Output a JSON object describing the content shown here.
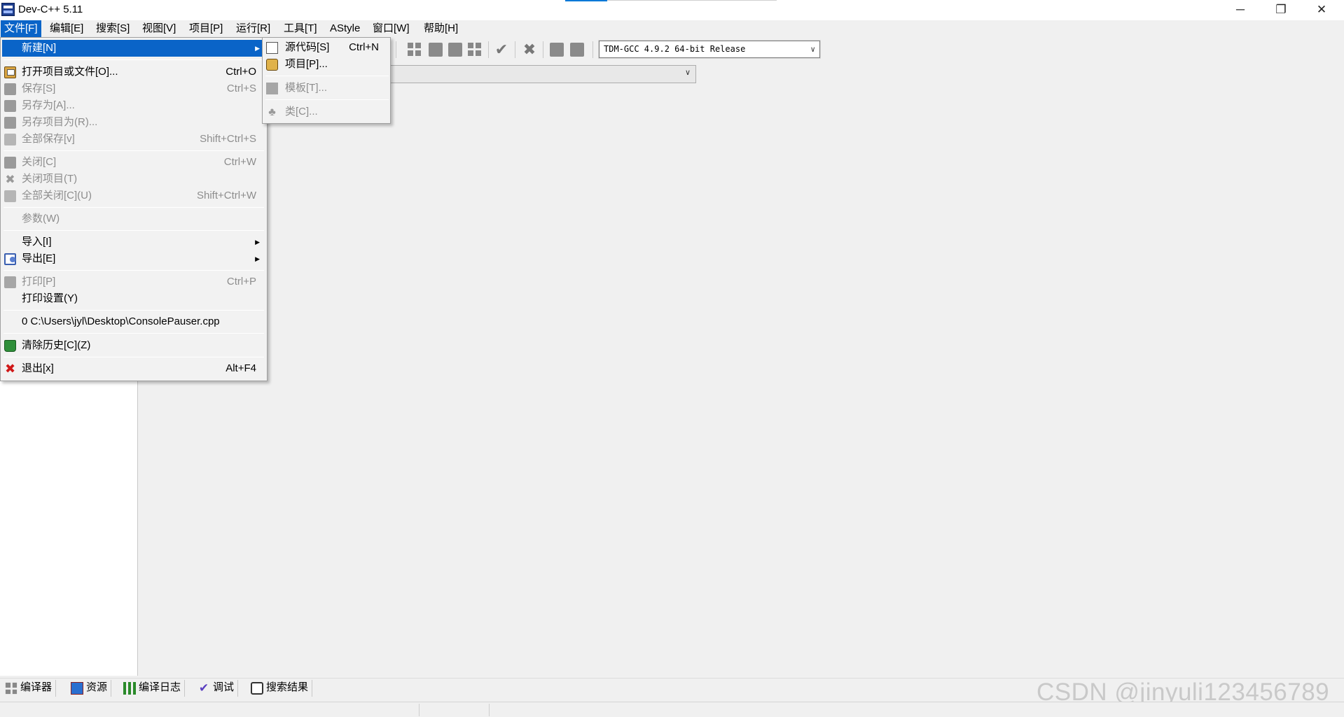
{
  "window": {
    "title": "Dev-C++ 5.11",
    "minimize_glyph": "─",
    "maximize_glyph": "❐",
    "close_glyph": "✕"
  },
  "menubar": [
    {
      "label": "文件[F]",
      "active": true
    },
    {
      "label": "编辑[E]"
    },
    {
      "label": "搜索[S]"
    },
    {
      "label": "视图[V]"
    },
    {
      "label": "项目[P]"
    },
    {
      "label": "运行[R]"
    },
    {
      "label": "工具[T]"
    },
    {
      "label": "AStyle"
    },
    {
      "label": "窗口[W]"
    },
    {
      "label": "帮助[H]"
    }
  ],
  "toolbar": {
    "compiler_select_value": "TDM-GCC 4.9.2 64-bit Release",
    "chevron": "∨"
  },
  "file_menu": {
    "items": [
      {
        "label": "新建[N]",
        "arrow": "▶",
        "highlighted": true
      },
      {
        "label": "打开项目或文件[O]...",
        "shortcut": "Ctrl+O",
        "icon": "open-icon"
      },
      {
        "label": "保存[S]",
        "shortcut": "Ctrl+S",
        "disabled": true,
        "icon": "save-icon"
      },
      {
        "label": "另存为[A]...",
        "disabled": true,
        "icon": "save-as-icon"
      },
      {
        "label": "另存项目为(R)...",
        "disabled": true,
        "icon": "save-project-as-icon"
      },
      {
        "label": "全部保存[v]",
        "shortcut": "Shift+Ctrl+S",
        "disabled": true,
        "icon": "save-all-icon"
      },
      {
        "label": "关闭[C]",
        "shortcut": "Ctrl+W",
        "disabled": true,
        "icon": "close-file-icon"
      },
      {
        "label": "关闭项目(T)",
        "disabled": true,
        "icon": "close-project-icon"
      },
      {
        "label": "全部关闭[C](U)",
        "shortcut": "Shift+Ctrl+W",
        "disabled": true,
        "icon": "close-all-icon"
      },
      {
        "label": "参数(W)",
        "disabled": true
      },
      {
        "label": "导入[I]",
        "arrow": "▶"
      },
      {
        "label": "导出[E]",
        "arrow": "▶",
        "icon": "export-icon"
      },
      {
        "label": "打印[P]",
        "shortcut": "Ctrl+P",
        "disabled": true,
        "icon": "print-icon"
      },
      {
        "label": "打印设置(Y)"
      },
      {
        "label": "0 C:\\Users\\jyl\\Desktop\\ConsolePauser.cpp"
      },
      {
        "label": "清除历史[C](Z)",
        "icon": "clear-history-icon"
      },
      {
        "label": "退出[x]",
        "shortcut": "Alt+F4",
        "icon": "exit-icon"
      }
    ]
  },
  "new_submenu": {
    "items": [
      {
        "label": "源代码[S]",
        "shortcut": "Ctrl+N",
        "icon": "source-file-icon"
      },
      {
        "label": "项目[P]...",
        "icon": "project-icon"
      },
      {
        "label": "模板[T]...",
        "disabled": true,
        "icon": "template-icon"
      },
      {
        "label": "类[C]...",
        "disabled": true,
        "icon": "class-icon"
      }
    ]
  },
  "bottom_tabs": [
    {
      "label": "编译器",
      "icon": "compiler-icon"
    },
    {
      "label": "资源",
      "icon": "resources-icon"
    },
    {
      "label": "编译日志",
      "icon": "compile-log-icon"
    },
    {
      "label": "调试",
      "icon": "debug-icon"
    },
    {
      "label": "搜索结果",
      "icon": "search-results-icon"
    }
  ],
  "watermark": "CSDN @jinyuli123456789"
}
